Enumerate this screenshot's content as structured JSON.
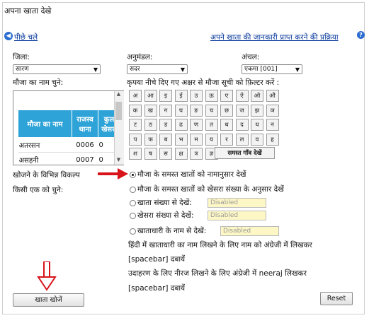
{
  "page_title": "अपना खाता देखे",
  "back_link": "पीछे चले",
  "process_link": "अपने खाता की जानकारी प्राप्त करने की प्रक्रिया",
  "district": {
    "label": "जिला:",
    "value": "सारण"
  },
  "subdivision": {
    "label": "अनुमंडल:",
    "value": "सदर"
  },
  "circle": {
    "label": "अंचल:",
    "value": "एकमा [001]"
  },
  "mauja_label": "मौजा का नाम चुने:",
  "filter_hint": "कृपया नीचे दिए गए अक्षर से मौजा सूची को फ़िल्टर करें :",
  "village_table": {
    "headers": [
      "मौजा का नाम",
      "राजस्व थाना",
      "कुल खेसरा"
    ],
    "rows": [
      [
        "अतरसन",
        "0006",
        "0"
      ],
      [
        "असहनी",
        "0007",
        "0"
      ]
    ]
  },
  "letters": [
    [
      "अ",
      "आ",
      "इ",
      "ई",
      "उ",
      "ऊ",
      "ए",
      "ऐ",
      "ओ",
      "औ"
    ],
    [
      "क",
      "ख",
      "ग",
      "घ",
      "ङ",
      "च",
      "छ",
      "ज",
      "झ",
      "ञ"
    ],
    [
      "ट",
      "ठ",
      "ड",
      "ढ",
      "ण",
      "त",
      "थ",
      "द",
      "ध",
      "न"
    ],
    [
      "प",
      "फ",
      "ब",
      "भ",
      "म",
      "य",
      "र",
      "ल",
      "व",
      "ह"
    ],
    [
      "श",
      "ष",
      "स",
      "क्ष",
      "त्र",
      "ज्ञ"
    ]
  ],
  "all_villages_button": "समस्त गाँव देखें",
  "search_options_label": "खोजने के विभिन्न विकल्प",
  "choose_one_label": "किसी एक को चुने:",
  "options": {
    "by_name": "मौजा के समस्त खातों को नामानुसार देखें",
    "by_khesra": "मौजा के समस्त खातों को खेसरा संख्या के अनुसार देखें",
    "by_khata_no": "खाता संख्या से देखें:",
    "by_khesra_no": "खेसरा संख्या से देखें:",
    "by_holder_name": "खाताधारी के नाम से देखें:"
  },
  "disabled_text": "Disabled",
  "instruction_1": "हिंदी में खाताधारी का नाम लिखने के लिए नाम को अंग्रेजी में लिखकर",
  "spacebar_1": "[spacebar] दबायें",
  "instruction_2": "उदाहरण के लिए नीरज लिखने के लिए अंग्रेजी में neeraj लिखकर",
  "spacebar_2": "[spacebar] दबायें",
  "search_button": "खाता खोजें",
  "reset_button": "Reset",
  "colors": {
    "table_header": "#2ea3d8",
    "arrow_red": "#d8141a",
    "disabled_bg": "#fdf7c6",
    "link": "#003399"
  }
}
